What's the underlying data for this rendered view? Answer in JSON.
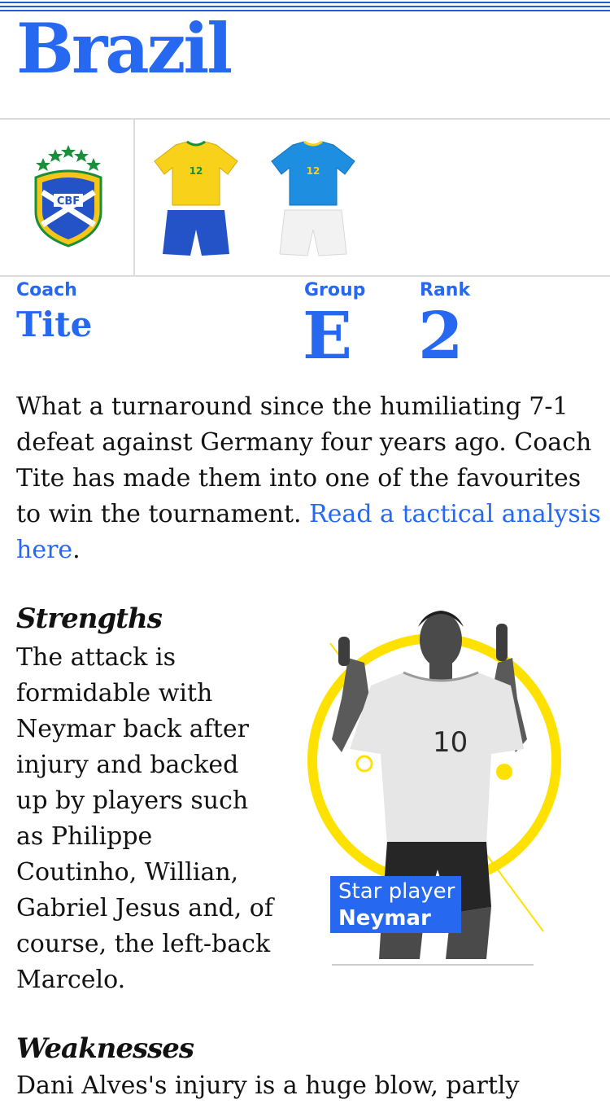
{
  "team": {
    "name": "Brazil"
  },
  "crest": {
    "text": "CBF"
  },
  "kits": [
    {
      "name": "home-kit",
      "number": "12",
      "shirt_color": "#f7d11a",
      "shorts_color": "#2453c8"
    },
    {
      "name": "away-kit",
      "number": "12",
      "shirt_color": "#1e8ee0",
      "shorts_color": "#f2f2f2"
    }
  ],
  "stats": {
    "coach": {
      "label": "Coach",
      "value": "Tite"
    },
    "group": {
      "label": "Group",
      "value": "E"
    },
    "rank": {
      "label": "Rank",
      "value": "2"
    }
  },
  "intro": {
    "text": "What a turnaround since the humiliating 7-1 defeat against Germany four years ago. Coach Tite has made them into one of the favourites to win the tournament. ",
    "link": "Read a tactical analysis here",
    "end": "."
  },
  "strengths": {
    "heading": "Strengths",
    "lines": [
      "The attack is",
      "formidable with",
      "Neymar back after",
      "injury and backed",
      "up by players such",
      "as Philippe",
      "Coutinho, Willian,",
      "Gabriel Jesus and, of",
      "course, the left-back",
      "Marcelo."
    ]
  },
  "star_player": {
    "label": "Star player",
    "name": "Neymar",
    "shirt_number": "10"
  },
  "weaknesses": {
    "heading": "Weaknesses",
    "text": "Dani Alves's injury is a huge blow, partly"
  },
  "colors": {
    "accent": "#2768f0",
    "highlight_yellow": "#ffe100"
  }
}
